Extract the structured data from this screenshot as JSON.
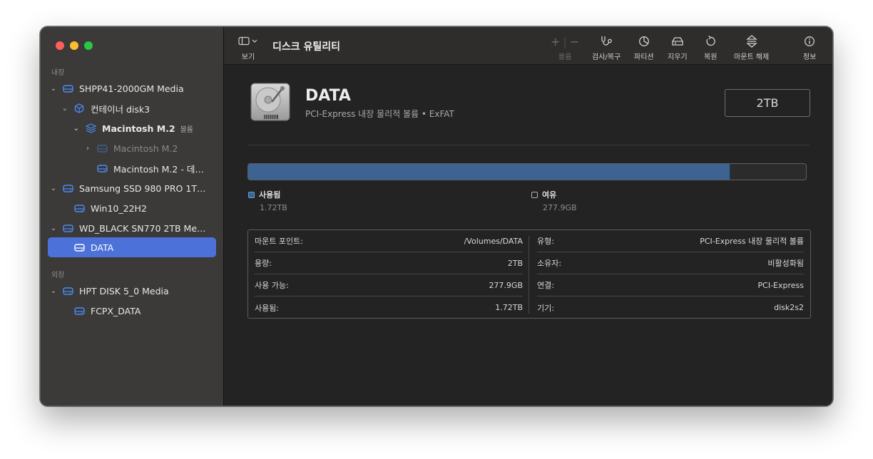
{
  "sidebar": {
    "section_internal": "내장",
    "section_external": "외장",
    "items": [
      {
        "label": "SHPP41-2000GM Media",
        "chevron": "⌄",
        "icon": "disk-icon"
      },
      {
        "label": "컨테이너 disk3",
        "chevron": "⌄",
        "icon": "container-icon"
      },
      {
        "label": "Macintosh M.2",
        "tag": "볼륨",
        "chevron": "⌄",
        "icon": "volume-stack-icon"
      },
      {
        "label": "Macintosh M.2",
        "chevron": "›",
        "icon": "volume-icon"
      },
      {
        "label": "Macintosh M.2 - 데…",
        "chevron": "",
        "icon": "volume-icon"
      },
      {
        "label": "Samsung SSD 980 PRO 1T…",
        "chevron": "⌄",
        "icon": "disk-icon"
      },
      {
        "label": "Win10_22H2",
        "chevron": "",
        "icon": "volume-icon"
      },
      {
        "label": "WD_BLACK SN770 2TB Me…",
        "chevron": "⌄",
        "icon": "disk-icon"
      },
      {
        "label": "DATA",
        "chevron": "",
        "icon": "volume-icon"
      },
      {
        "label": "HPT DISK 5_0 Media",
        "chevron": "⌄",
        "icon": "disk-icon"
      },
      {
        "label": "FCPX_DATA",
        "chevron": "",
        "icon": "volume-icon"
      }
    ]
  },
  "toolbar": {
    "view_label": "보기",
    "title": "디스크 유틸리티",
    "volume_label": "볼륨",
    "add_symbol": "+",
    "remove_symbol": "−",
    "firstaid_label": "검사/복구",
    "partition_label": "파티션",
    "erase_label": "지우기",
    "restore_label": "복원",
    "unmount_label": "마운트 해제",
    "info_label": "정보"
  },
  "volume": {
    "name": "DATA",
    "subtitle": "PCI-Express 내장 물리적 볼륨 • ExFAT",
    "capacity": "2TB",
    "used_fraction": 0.865,
    "used_label": "사용됨",
    "used_value": "1.72TB",
    "free_label": "여유",
    "free_value": "277.9GB"
  },
  "info": {
    "left": [
      {
        "key": "마운트 포인트:",
        "value": "/Volumes/DATA"
      },
      {
        "key": "용량:",
        "value": "2TB"
      },
      {
        "key": "사용 가능:",
        "value": "277.9GB"
      },
      {
        "key": "사용됨:",
        "value": "1.72TB"
      }
    ],
    "right": [
      {
        "key": "유형:",
        "value": "PCI-Express 내장 물리적 볼륨"
      },
      {
        "key": "소유자:",
        "value": "비활성화됨"
      },
      {
        "key": "연결:",
        "value": "PCI-Express"
      },
      {
        "key": "기기:",
        "value": "disk2s2"
      }
    ]
  },
  "colors": {
    "accent": "#4c71d9",
    "used_fill": "#3c6391",
    "icon_blue": "#4a8bf5"
  }
}
